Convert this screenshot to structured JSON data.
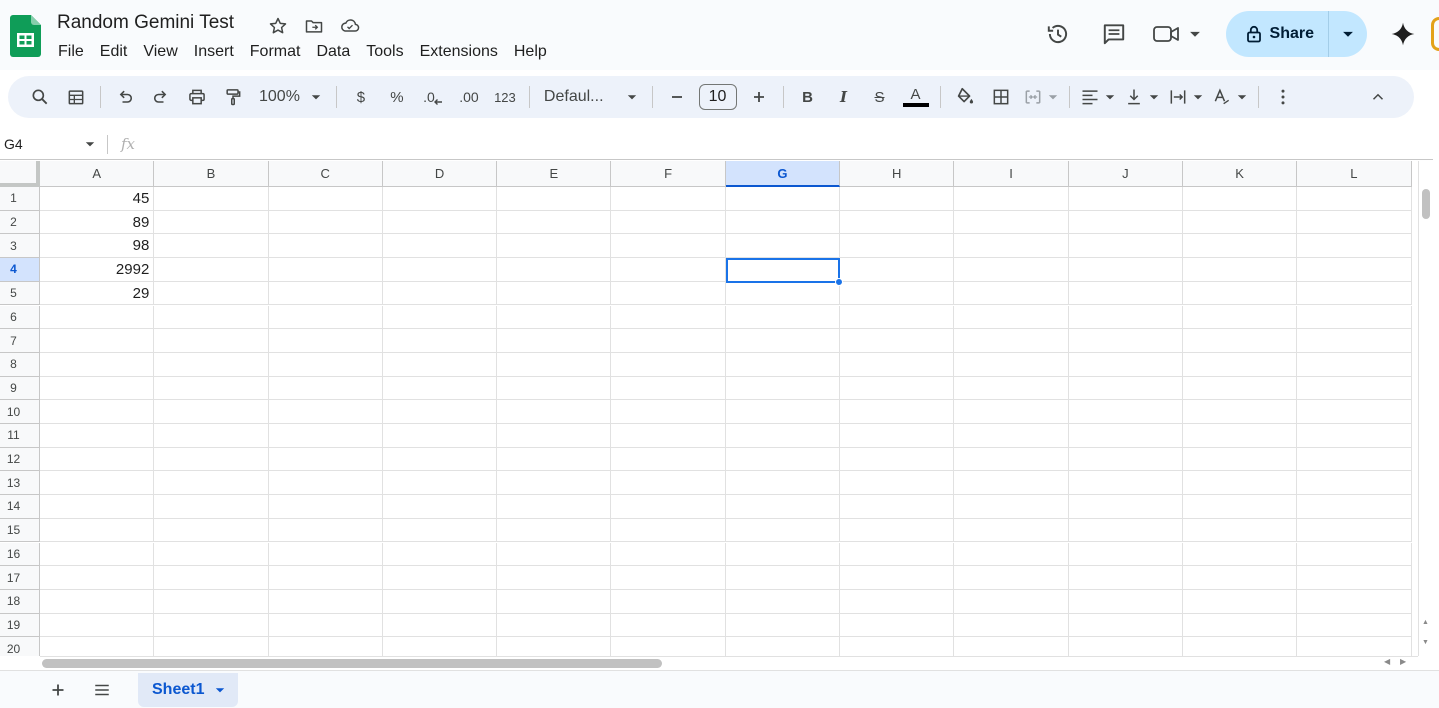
{
  "app": {
    "doc_title": "Random Gemini Test",
    "menu": [
      "File",
      "Edit",
      "View",
      "Insert",
      "Format",
      "Data",
      "Tools",
      "Extensions",
      "Help"
    ],
    "share_label": "Share",
    "icons": {
      "logo": "sheets-logo-icon",
      "star": "star-icon",
      "move": "move-to-folder-icon",
      "cloud": "cloud-saved-icon",
      "history": "version-history-icon",
      "comments": "comments-icon",
      "meet": "meet-video-icon",
      "lock": "lock-icon",
      "gemini": "gemini-sparkle-icon"
    }
  },
  "toolbar": {
    "zoom": "100%",
    "currency_symbol": "$",
    "percent_symbol": "%",
    "decrease_decimal": ".0",
    "increase_decimal": ".00",
    "more_formats": "123",
    "font": "Defaul...",
    "font_size": "10",
    "bold": "B",
    "italic": "I",
    "strike": "S",
    "text_color_letter": "A",
    "text_color": "#000000"
  },
  "formula_bar": {
    "cell_ref": "G4",
    "fx": "fx",
    "content": ""
  },
  "grid": {
    "columns": [
      "A",
      "B",
      "C",
      "D",
      "E",
      "F",
      "G",
      "H",
      "I",
      "J",
      "K",
      "L"
    ],
    "rows": [
      "1",
      "2",
      "3",
      "4",
      "5",
      "6",
      "7",
      "8",
      "9",
      "10",
      "11",
      "12",
      "13",
      "14",
      "15",
      "16",
      "17",
      "18",
      "19",
      "20"
    ],
    "selected_column": "G",
    "selected_row": "4",
    "cells": {
      "A1": "45",
      "A2": "89",
      "A3": "98",
      "A4": "2992",
      "A5": "29"
    }
  },
  "sheets": {
    "tabs": [
      "Sheet1"
    ],
    "active": "Sheet1"
  },
  "colors": {
    "accent": "#0b57d0",
    "selection": "#1a73e8",
    "share_bg": "#c2e7ff",
    "header_selected": "#d3e3fd",
    "toolbar_bg": "#edf2fa"
  }
}
